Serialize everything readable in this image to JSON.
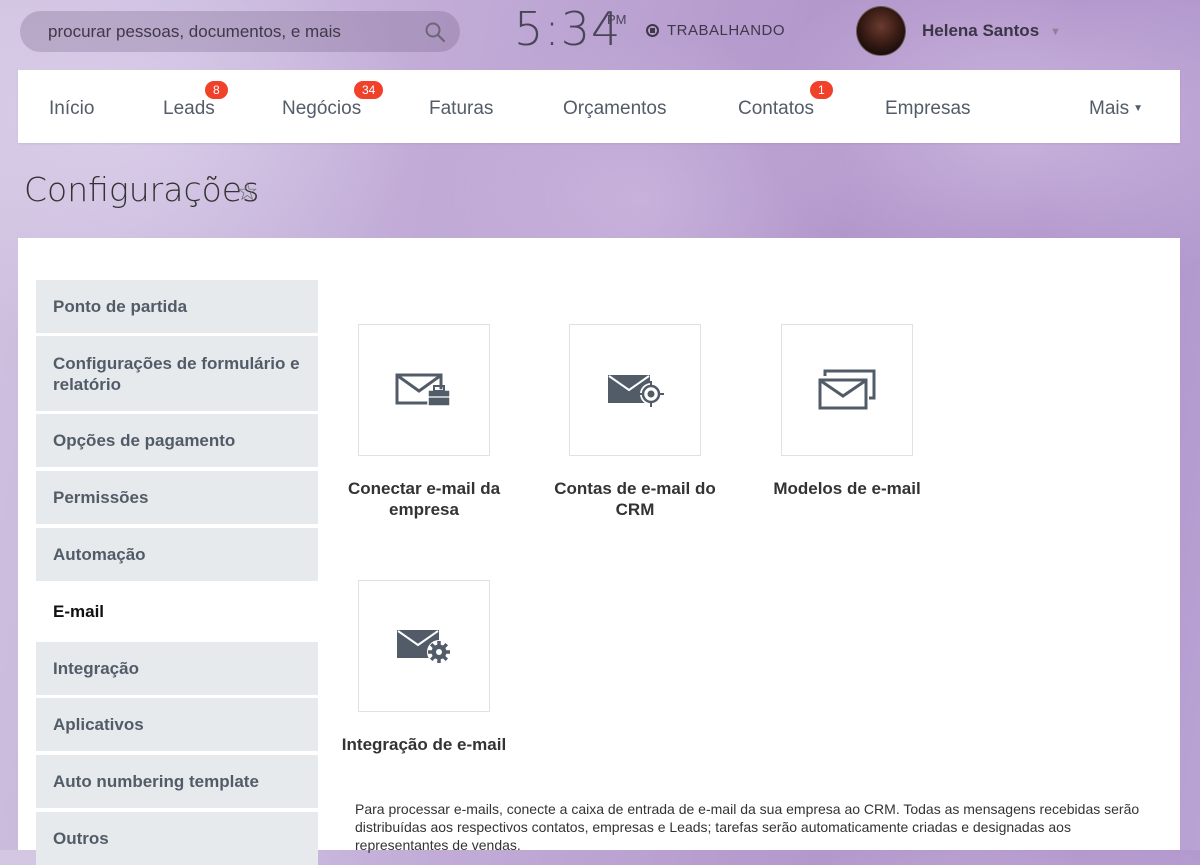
{
  "topbar": {
    "search_placeholder": "procurar pessoas, documentos, e mais",
    "clock_time": "5:34",
    "clock_ampm": "PM",
    "work_status": "TRABALHANDO",
    "user_name": "Helena Santos"
  },
  "nav": {
    "items": [
      {
        "label": "Início",
        "badge": null
      },
      {
        "label": "Leads",
        "badge": "8"
      },
      {
        "label": "Negócios",
        "badge": "34"
      },
      {
        "label": "Faturas",
        "badge": null
      },
      {
        "label": "Orçamentos",
        "badge": null
      },
      {
        "label": "Contatos",
        "badge": "1"
      },
      {
        "label": "Empresas",
        "badge": null
      },
      {
        "label": "Mais",
        "badge": null
      }
    ]
  },
  "page": {
    "title": "Configurações"
  },
  "sidebar": {
    "items": [
      {
        "label": "Ponto de partida",
        "active": false
      },
      {
        "label": "Configurações de formulário e relatório",
        "active": false
      },
      {
        "label": "Opções de pagamento",
        "active": false
      },
      {
        "label": "Permissões",
        "active": false
      },
      {
        "label": "Automação",
        "active": false
      },
      {
        "label": "E-mail",
        "active": true
      },
      {
        "label": "Integração",
        "active": false
      },
      {
        "label": "Aplicativos",
        "active": false
      },
      {
        "label": "Auto numbering template",
        "active": false
      },
      {
        "label": "Outros",
        "active": false
      }
    ]
  },
  "tiles": [
    {
      "label": "Conectar e-mail da empresa",
      "icon": "mail-briefcase-icon"
    },
    {
      "label": "Contas de e-mail do CRM",
      "icon": "mail-target-icon"
    },
    {
      "label": "Modelos de e-mail",
      "icon": "mail-templates-icon"
    },
    {
      "label": "Integração de e-mail",
      "icon": "mail-settings-icon"
    }
  ],
  "description": "Para processar e-mails, conecte a caixa de entrada de e-mail da sua empresa ao CRM. Todas as mensagens recebidas serão distribuídas aos respectivos contatos, empresas e Leads; tarefas serão automaticamente criadas e designadas aos representantes de vendas.",
  "colors": {
    "badge": "#f0412b",
    "icon": "#525c69",
    "menu_bg": "#e7eaec"
  }
}
